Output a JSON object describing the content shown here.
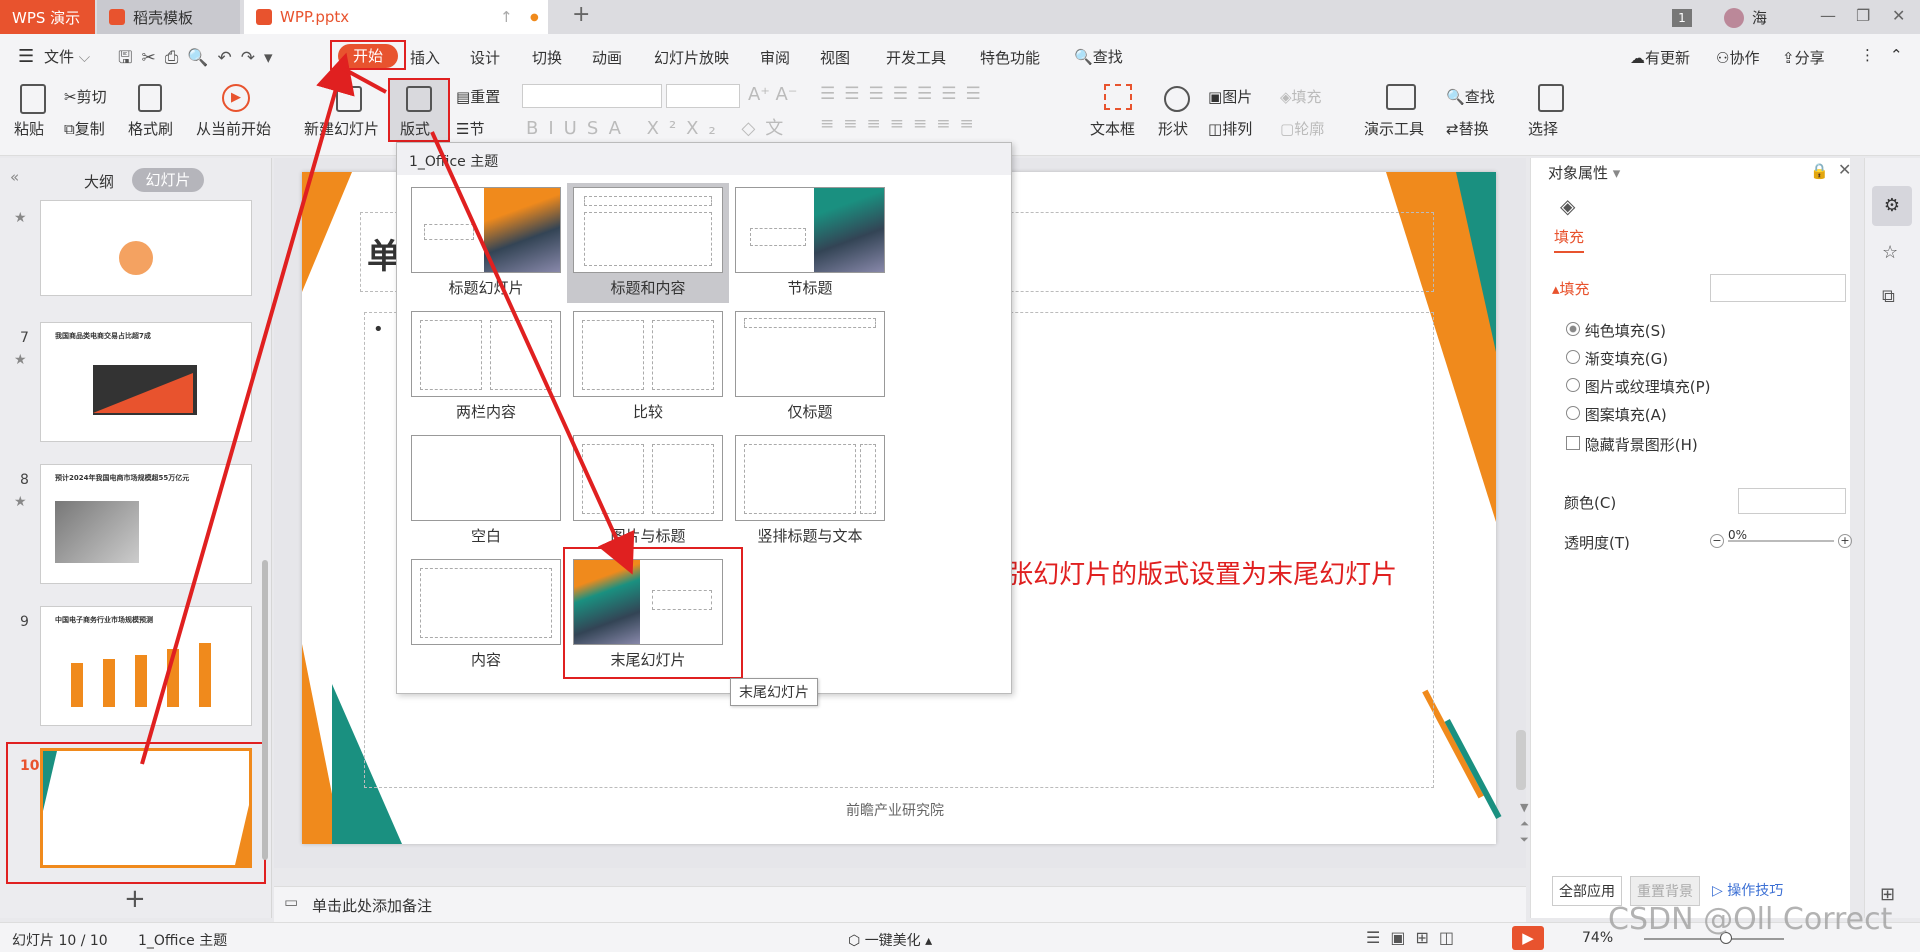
{
  "titlebar": {
    "tab_wps": "WPS 演示",
    "tab_daoke": "稻壳模板",
    "tab_doc": "WPP.pptx",
    "badge": "1",
    "user": "海"
  },
  "menubar": {
    "file": "文件",
    "items": [
      "开始",
      "插入",
      "设计",
      "切换",
      "动画",
      "幻灯片放映",
      "审阅",
      "视图",
      "开发工具",
      "特色功能"
    ],
    "search": "查找",
    "right": [
      "有更新",
      "协作",
      "分享"
    ]
  },
  "ribbon": {
    "paste": "粘贴",
    "cut": "剪切",
    "copy": "复制",
    "format_painter": "格式刷",
    "from_current": "从当前开始",
    "new_slide": "新建幻灯片",
    "layout": "版式",
    "reset": "重置",
    "section": "节",
    "textbox": "文本框",
    "shape": "形状",
    "picture": "图片",
    "fill": "填充",
    "arrange": "排列",
    "outline": "轮廓",
    "present_tools": "演示工具",
    "find": "查找",
    "replace": "替换",
    "select": "选择"
  },
  "leftpanel": {
    "tab_outline": "大纲",
    "tab_slides": "幻灯片",
    "slides": [
      {
        "num": "7",
        "title": "我国商品类电商交易占比超7成"
      },
      {
        "num": "8",
        "title": "预计2024年我国电商市场规模超55万亿元"
      },
      {
        "num": "9",
        "title": "中国电子商务行业市场规模预测"
      },
      {
        "num": "10",
        "title": ""
      }
    ]
  },
  "dropdown": {
    "header": "1_Office 主题",
    "layouts": [
      "标题幻灯片",
      "标题和内容",
      "节标题",
      "两栏内容",
      "比较",
      "仅标题",
      "空白",
      "图片与标题",
      "竖排标题与文本",
      "内容",
      "末尾幻灯片"
    ],
    "tooltip": "末尾幻灯片"
  },
  "slide": {
    "title_char": "单",
    "footer": "前瞻产业研究院",
    "annotation": "将第10张幻灯片的版式设置为末尾幻灯片"
  },
  "notes": {
    "placeholder": "单击此处添加备注"
  },
  "rightpanel": {
    "title": "对象属性",
    "tab_fill": "填充",
    "section_fill": "填充",
    "options": [
      "纯色填充(S)",
      "渐变填充(G)",
      "图片或纹理填充(P)",
      "图案填充(A)"
    ],
    "hide_bg": "隐藏背景图形(H)",
    "color_label": "颜色(C)",
    "transparency_label": "透明度(T)",
    "transparency_value": "0%",
    "apply_all": "全部应用",
    "reset_bg": "重置背景",
    "tips": "操作技巧"
  },
  "status": {
    "slide_count": "幻灯片 10 / 10",
    "theme": "1_Office 主题",
    "beautify": "一键美化",
    "zoom": "74%",
    "watermark": "CSDN @Oll Correct"
  },
  "colors": {
    "accent": "#e8532e",
    "teal": "#1a9080",
    "orange": "#f08a1c",
    "annotation": "#e02020"
  }
}
